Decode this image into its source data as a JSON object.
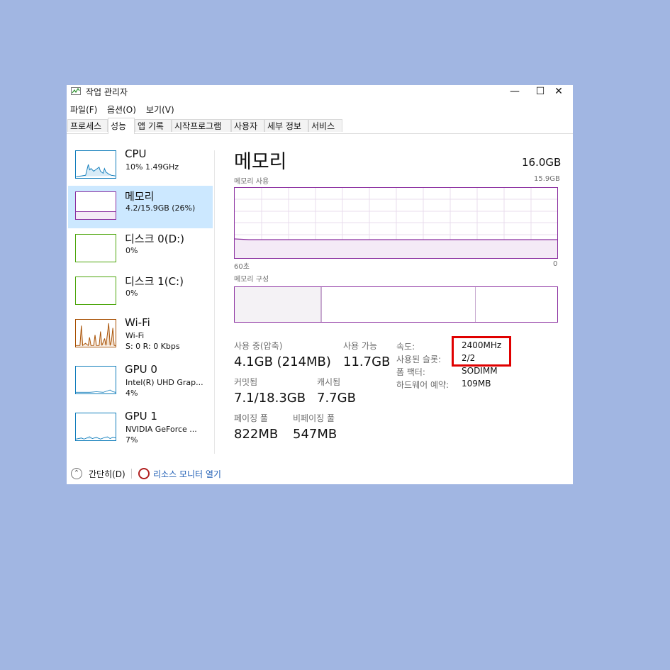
{
  "window": {
    "title": "작업 관리자",
    "controls": {
      "minimize": "—",
      "maximize": "☐",
      "close": "✕"
    }
  },
  "menu": [
    "파일(F)",
    "옵션(O)",
    "보기(V)"
  ],
  "tabs": [
    {
      "label": "프로세스",
      "active": false
    },
    {
      "label": "성능",
      "active": true
    },
    {
      "label": "앱 기록",
      "active": false
    },
    {
      "label": "시작프로그램",
      "active": false
    },
    {
      "label": "사용자",
      "active": false
    },
    {
      "label": "세부 정보",
      "active": false
    },
    {
      "label": "서비스",
      "active": false
    }
  ],
  "sidebar": {
    "items": [
      {
        "name": "CPU",
        "sub1": "10% 1.49GHz",
        "color": "#117dbb",
        "active": false
      },
      {
        "name": "메모리",
        "sub1": "4.2/15.9GB (26%)",
        "color": "#8b2fa0",
        "active": true,
        "usage_fraction": 0.26
      },
      {
        "name": "디스크 0(D:)",
        "sub1": "0%",
        "color": "#4da60c",
        "active": false
      },
      {
        "name": "디스크 1(C:)",
        "sub1": "0%",
        "color": "#4da60c",
        "active": false
      },
      {
        "name": "Wi-Fi",
        "sub1": "Wi-Fi",
        "sub2": "S: 0 R: 0 Kbps",
        "color": "#a74f01",
        "active": false
      },
      {
        "name": "GPU 0",
        "sub1": "Intel(R) UHD Grap...",
        "sub2": "4%",
        "color": "#117dbb",
        "active": false
      },
      {
        "name": "GPU 1",
        "sub1": "NVIDIA GeForce ...",
        "sub2": "7%",
        "color": "#117dbb",
        "active": false
      }
    ]
  },
  "main": {
    "title": "메모리",
    "total": "16.0GB",
    "usage_graph": {
      "label": "메모리 사용",
      "max": "15.9GB",
      "x_left": "60초",
      "x_right": "0"
    },
    "composition_label": "메모리 구성",
    "stats": {
      "in_use_label": "사용 중(압축)",
      "in_use_value": "4.1GB (214MB)",
      "available_label": "사용 가능",
      "available_value": "11.7GB",
      "committed_label": "커밋됨",
      "committed_value": "7.1/18.3GB",
      "cached_label": "캐시됨",
      "cached_value": "7.7GB",
      "paged_label": "페이징 풀",
      "paged_value": "822MB",
      "nonpaged_label": "비페이징 풀",
      "nonpaged_value": "547MB"
    },
    "details": {
      "speed_label": "속도:",
      "speed_value": "2400MHz",
      "slots_label": "사용된 슬롯:",
      "slots_value": "2/2",
      "form_label": "폼 팩터:",
      "form_value": "SODIMM",
      "reserved_label": "하드웨어 예약:",
      "reserved_value": "109MB"
    }
  },
  "footer": {
    "fewer_details": "간단히(D)",
    "resource_monitor": "리소스 모니터 열기"
  },
  "colors": {
    "memory": "#8b2fa0",
    "highlight": "#e00000",
    "background": "#a1b6e2"
  }
}
